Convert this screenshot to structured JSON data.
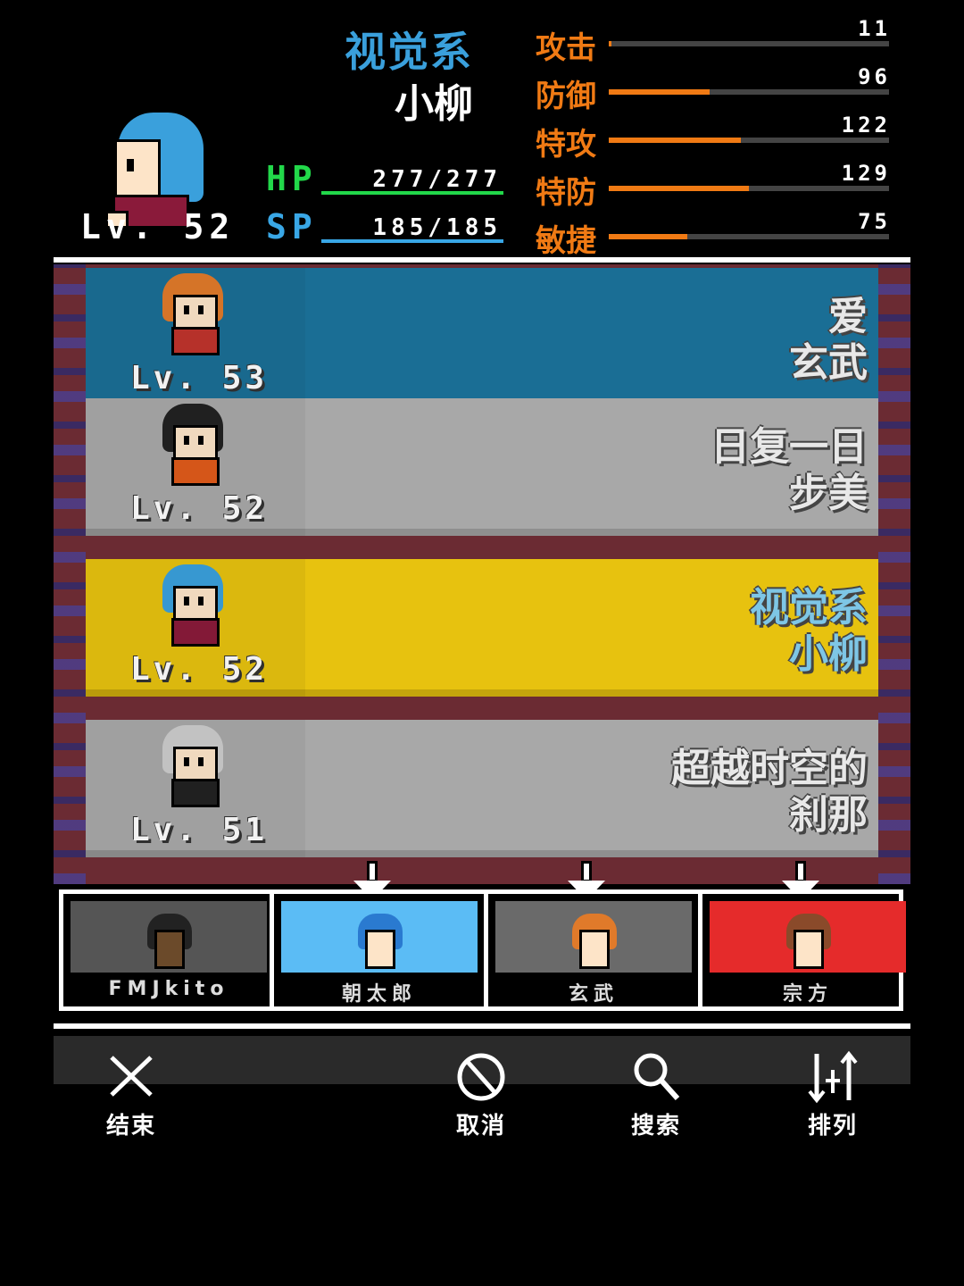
{
  "selected": {
    "title": "视觉系",
    "name": "小柳",
    "level": "Lv. 52",
    "hp_label": "HP",
    "hp": "277/277",
    "sp_label": "SP",
    "sp": "185/185",
    "stats": [
      {
        "label": "攻击",
        "value": "11",
        "fill": 0.01
      },
      {
        "label": "防御",
        "value": "96",
        "fill": 0.36
      },
      {
        "label": "特攻",
        "value": "122",
        "fill": 0.47
      },
      {
        "label": "特防",
        "value": "129",
        "fill": 0.5
      },
      {
        "label": "敏捷",
        "value": "75",
        "fill": 0.28
      }
    ]
  },
  "roster": [
    {
      "level": "Lv. 53",
      "line1": "爱",
      "line2": "玄武",
      "bg": "#1a6e95",
      "text_color": "#e8e8e8",
      "hair": "#e07a2a",
      "body": "#c0342c"
    },
    {
      "level": "Lv. 52",
      "line1": "日复一日",
      "line2": "步美",
      "bg": "#a8a8a8",
      "text_color": "#e8e8e8",
      "hair": "#222222",
      "body": "#e05a1a"
    },
    {
      "level": "Lv. 52",
      "line1": "视觉系",
      "line2": "小柳",
      "bg": "#e7c20f",
      "text_color": "#7ec6e6",
      "hair": "#3aa0dc",
      "body": "#8a1a3a"
    },
    {
      "level": "Lv. 51",
      "line1": "超越时空的",
      "line2": "刹那",
      "bg": "#a8a8a8",
      "text_color": "#e8e8e8",
      "hair": "#cccccc",
      "body": "#222222"
    }
  ],
  "party": [
    {
      "name": "FMJkito",
      "bg": "#555555",
      "hair": "#222222",
      "face": "#6b4a2a"
    },
    {
      "name": "朝太郎",
      "bg": "#5bbcf5",
      "hair": "#2a7ad0",
      "face": "#fde4c8"
    },
    {
      "name": "玄武",
      "bg": "#6a6a6a",
      "hair": "#e07a2a",
      "face": "#fde4c8"
    },
    {
      "name": "宗方",
      "bg": "#e52b2b",
      "hair": "#8a4a2a",
      "face": "#fde4c8"
    }
  ],
  "toolbar": {
    "end": "结束",
    "cancel": "取消",
    "search": "搜索",
    "sort": "排列"
  }
}
